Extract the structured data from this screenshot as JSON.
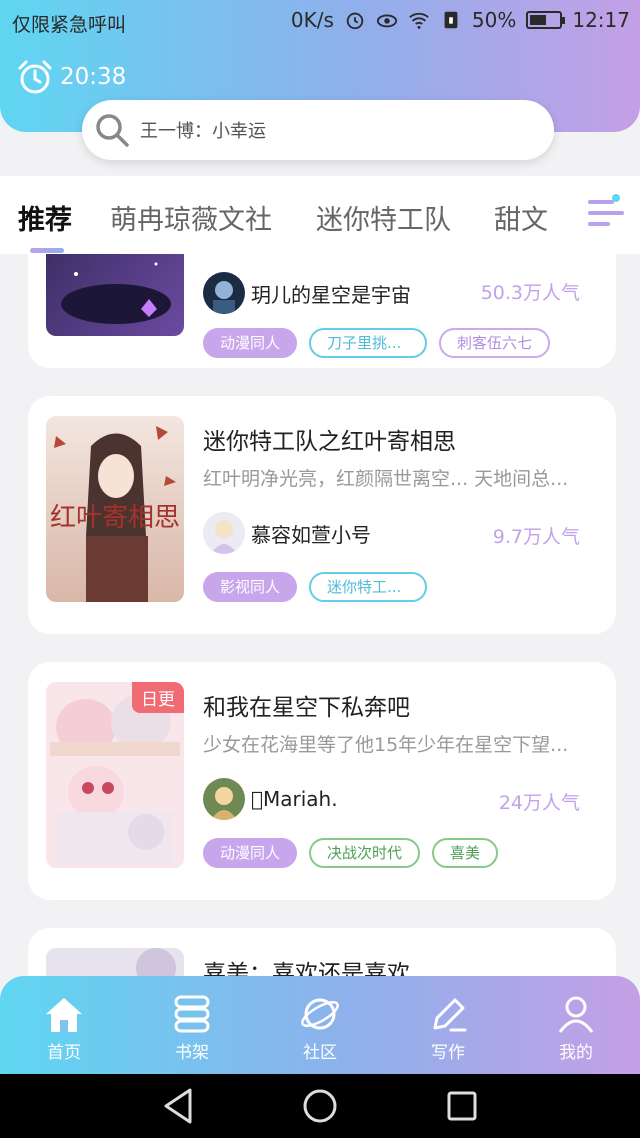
{
  "status_bar": {
    "carrier": "仅限紧急呼叫",
    "speed": "0K/s",
    "battery": "50%",
    "battery_level": 0.5,
    "time": "12:17"
  },
  "header": {
    "timer": "20:38",
    "search_text": "王一博：小幸运"
  },
  "tabs": [
    "推荐",
    "萌冉琼薇文社",
    "迷你特工队",
    "甜文"
  ],
  "active_tab": 0,
  "cards": [
    {
      "title": "",
      "desc": "",
      "author": "玥儿的星空是宇宙",
      "popularity": "50.3万人气",
      "tags": [
        "动漫同人",
        "刀子里挑...",
        "刺客伍六七"
      ]
    },
    {
      "title": "迷你特工队之红叶寄相思",
      "desc": "红叶明净光亮，红颜隔世离空... 天地间总...",
      "author": "慕容如萱小号",
      "popularity": "9.7万人气",
      "tags": [
        "影视同人",
        "迷你特工..."
      ],
      "cover_text": "红叶寄相思"
    },
    {
      "title": "和我在星空下私奔吧",
      "desc": "少女在花海里等了他15年少年在星空下望...",
      "author": "\u0000Mariah.",
      "popularity": "24万人气",
      "tags": [
        "动漫同人",
        "决战次时代",
        "喜美"
      ],
      "badge": "日更"
    },
    {
      "title": "喜美：喜欢还是喜欢"
    }
  ],
  "bottom_nav": [
    {
      "label": "首页",
      "icon": "home-icon"
    },
    {
      "label": "书架",
      "icon": "bookshelf-icon"
    },
    {
      "label": "社区",
      "icon": "planet-icon"
    },
    {
      "label": "写作",
      "icon": "pen-icon"
    },
    {
      "label": "我的",
      "icon": "user-icon"
    }
  ],
  "colors": {
    "gradient_start": "#5fd6f2",
    "gradient_end": "#c49fe6",
    "popularity": "#c3a2ea",
    "badge": "#f06b73"
  }
}
